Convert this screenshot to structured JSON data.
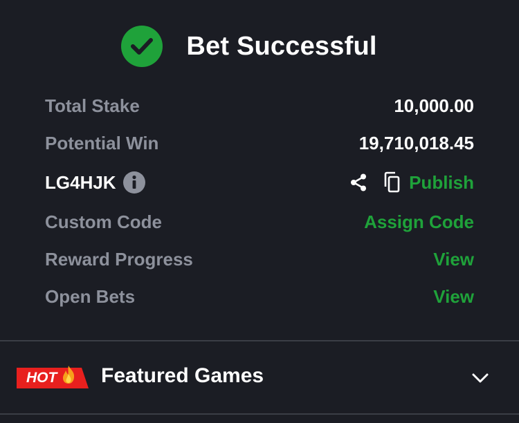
{
  "header": {
    "title": "Bet Successful",
    "icon": "check-circle-icon",
    "icon_color": "#1fa23a"
  },
  "summary": {
    "total_stake_label": "Total Stake",
    "total_stake_value": "10,000.00",
    "potential_win_label": "Potential Win",
    "potential_win_value": "19,710,018.45",
    "booking_code": "LG4HJK",
    "publish_label": "Publish",
    "custom_code_label": "Custom Code",
    "custom_code_action": "Assign Code",
    "reward_progress_label": "Reward Progress",
    "reward_progress_action": "View",
    "open_bets_label": "Open Bets",
    "open_bets_action": "View"
  },
  "featured": {
    "badge": "HOT",
    "title": "Featured Games"
  },
  "colors": {
    "background": "#1b1d24",
    "accent_green": "#1fa23a",
    "label_gray": "#8d919c",
    "hot_red": "#e8201e",
    "divider": "#3b3e46"
  }
}
